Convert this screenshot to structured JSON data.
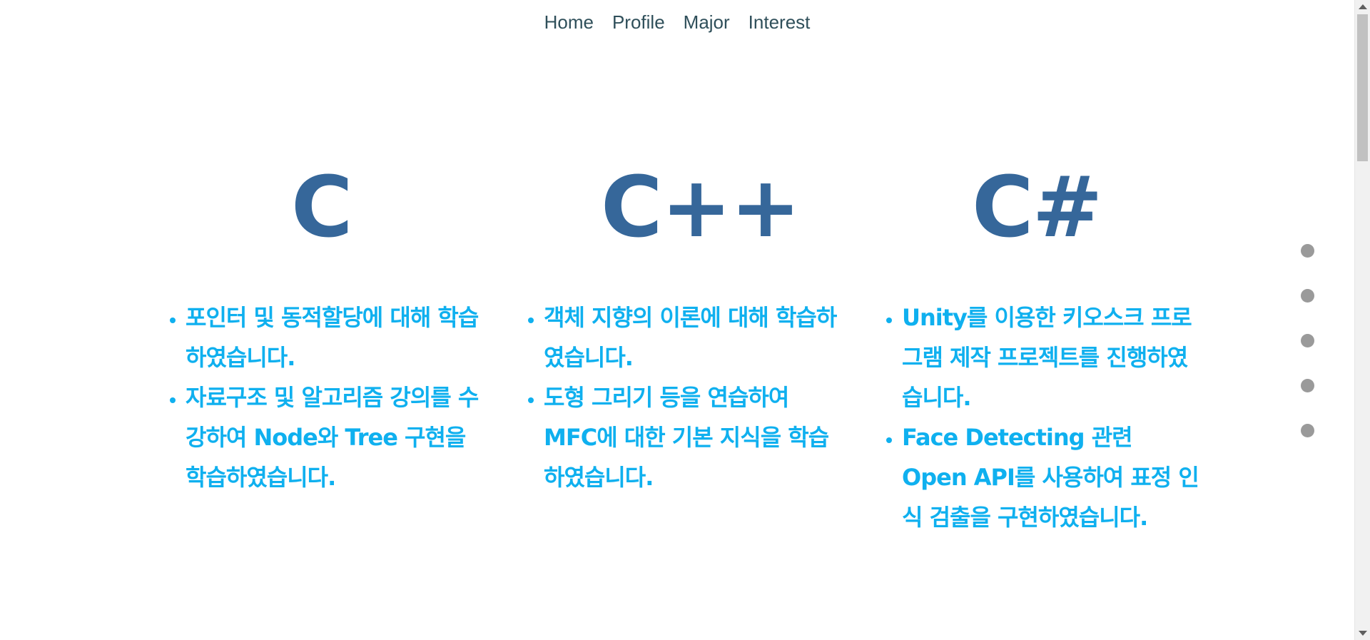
{
  "nav": {
    "items": [
      "Home",
      "Profile",
      "Major",
      "Interest"
    ]
  },
  "sections": [
    {
      "title": "C",
      "items": [
        "포인터 및 동적할당에 대해 학습하였습니다.",
        "자료구조 및 알고리즘 강의를 수강하여 Node와 Tree 구현을 학습하였습니다."
      ]
    },
    {
      "title": "C++",
      "items": [
        "객체 지향의 이론에 대해 학습하였습니다.",
        "도형 그리기 등을 연습하여 MFC에 대한 기본 지식을 학습하였습니다."
      ]
    },
    {
      "title": "C#",
      "items": [
        "Unity를 이용한 키오스크 프로그램 제작 프로젝트를 진행하였습니다.",
        "Face Detecting 관련 Open API를 사용하여 표정 인식 검출을 구현하였습니다."
      ]
    }
  ],
  "colors": {
    "nav_text": "#2f4f5a",
    "title": "#36679a",
    "bullet_text": "#0fb0ef",
    "dot": "#9a9a9a"
  },
  "side_nav": {
    "dot_count": 5
  }
}
